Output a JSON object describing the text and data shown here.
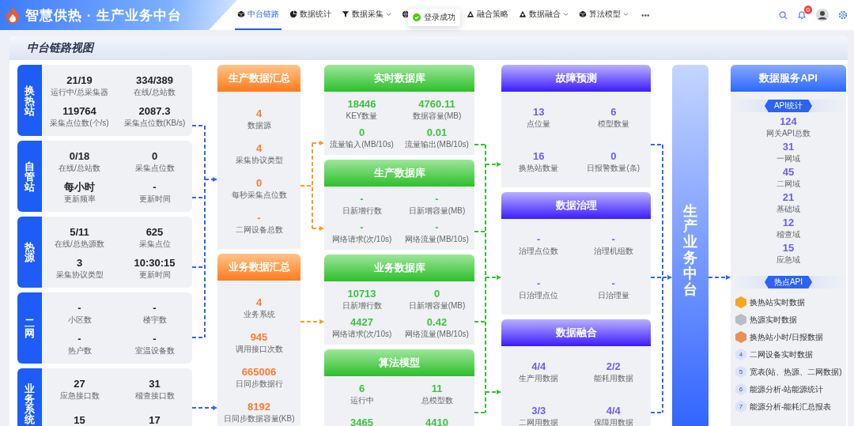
{
  "app": {
    "title": "智慧供热 · 生产业务中台"
  },
  "nav": [
    {
      "label": "中台链路",
      "selected": true,
      "dropdown": false
    },
    {
      "label": "数据统计",
      "selected": false,
      "dropdown": false
    },
    {
      "label": "数据采集",
      "selected": false,
      "dropdown": true
    },
    {
      "selected": false
    },
    {
      "label": "融合策略",
      "selected": false,
      "dropdown": false
    },
    {
      "label": "数据融合",
      "selected": false,
      "dropdown": true
    },
    {
      "label": "算法模型",
      "selected": false,
      "dropdown": true
    }
  ],
  "more": "•••",
  "notifications": {
    "badge": "0"
  },
  "toast": {
    "message": "登录成功"
  },
  "panel": {
    "title": "中台链路视图"
  },
  "sources": [
    {
      "name": "换热站",
      "metrics": [
        {
          "value": "21/19",
          "label": "运行中/总采集器"
        },
        {
          "value": "334/389",
          "label": "在线/总站数"
        },
        {
          "value": "119764",
          "label": "采集点位数(个/s)"
        },
        {
          "value": "2087.3",
          "label": "采集点位数(KB/s)"
        }
      ]
    },
    {
      "name": "自管站",
      "metrics": [
        {
          "value": "0/18",
          "label": "在线/总站数"
        },
        {
          "value": "0",
          "label": "采集点位数"
        },
        {
          "value": "每小时",
          "label": "更新频率"
        },
        {
          "value": "-",
          "label": "更新时间"
        }
      ]
    },
    {
      "name": "热源",
      "metrics": [
        {
          "value": "5/11",
          "label": "在线/总热源数"
        },
        {
          "value": "625",
          "label": "采集点位"
        },
        {
          "value": "3",
          "label": "采集协议类型"
        },
        {
          "value": "10:30:15",
          "label": "更新时间"
        }
      ]
    },
    {
      "name": "二网",
      "metrics": [
        {
          "value": "-",
          "label": "小区数"
        },
        {
          "value": "-",
          "label": "楼宇数"
        },
        {
          "value": "-",
          "label": "热户数"
        },
        {
          "value": "-",
          "label": "室温设备数"
        }
      ]
    },
    {
      "name": "业务系统",
      "metrics": [
        {
          "value": "27",
          "label": "应急接口数"
        },
        {
          "value": "31",
          "label": "稽查接口数"
        },
        {
          "value": "15"
        },
        {
          "value": "17"
        }
      ]
    }
  ],
  "summaries": [
    {
      "kind": "summary",
      "title": "生产数据汇总",
      "metrics": [
        {
          "value": "4",
          "label": "数据源"
        },
        {
          "value": "4",
          "label": "采集协议类型"
        },
        {
          "value": "0",
          "label": "每秒采集点位数"
        },
        {
          "value": "-",
          "label": "二网设备总数"
        }
      ]
    },
    {
      "kind": "summary",
      "title": "业务数据汇总",
      "metrics": [
        {
          "value": "4",
          "label": "业务系统"
        },
        {
          "value": "945",
          "label": "调用接口次数"
        },
        {
          "value": "665006",
          "label": "日同步数据行"
        },
        {
          "value": "8192",
          "label": "日同步数据容量(KB)"
        }
      ]
    }
  ],
  "databases": [
    {
      "kind": "database",
      "title": "实时数据库",
      "metrics": [
        {
          "value": "18446",
          "label": "KEY数量"
        },
        {
          "value": "4760.11",
          "label": "数据容量(MB)"
        },
        {
          "value": "0",
          "label": "流量输入(MB/10s)"
        },
        {
          "value": "0.01",
          "label": "流量输出(MB/10s)"
        }
      ]
    },
    {
      "kind": "database",
      "title": "生产数据库",
      "metrics": [
        {
          "value": "-",
          "label": "日新增行数"
        },
        {
          "value": "-",
          "label": "日新增容量(MB)"
        },
        {
          "value": "-",
          "label": "网络请求(次/10s)"
        },
        {
          "value": "-",
          "label": "网络流量(MB/10s)"
        }
      ]
    },
    {
      "kind": "database",
      "title": "业务数据库",
      "metrics": [
        {
          "value": "10713",
          "label": "日新增行数"
        },
        {
          "value": "0",
          "label": "日新增容量(MB)"
        },
        {
          "value": "4427",
          "label": "网络请求(次/10s)"
        },
        {
          "value": "0.42",
          "label": "网络流量(MB/10s)"
        }
      ]
    },
    {
      "kind": "database",
      "title": "算法模型",
      "metrics": [
        {
          "value": "6",
          "label": "运行中"
        },
        {
          "value": "11",
          "label": "总模型数"
        },
        {
          "value": "3465"
        },
        {
          "value": "4410"
        }
      ]
    }
  ],
  "services": [
    {
      "kind": "service",
      "title": "故障预测",
      "metrics": [
        {
          "value": "13",
          "label": "点位量"
        },
        {
          "value": "6",
          "label": "模型数量"
        },
        {
          "value": "16",
          "label": "换热站数量"
        },
        {
          "value": "0",
          "label": "日报警数量(条)"
        }
      ]
    },
    {
      "kind": "service",
      "title": "数据治理",
      "metrics": [
        {
          "value": "-",
          "label": "治理点位数"
        },
        {
          "value": "-",
          "label": "治理机组数"
        },
        {
          "value": "-",
          "label": "日治理点位"
        },
        {
          "value": "-",
          "label": "日治理量"
        }
      ]
    },
    {
      "kind": "service",
      "title": "数据融合",
      "metrics": [
        {
          "value": "4/4",
          "label": "生产用数据"
        },
        {
          "value": "2/2",
          "label": "能耗用数据"
        },
        {
          "value": "3/3",
          "label": "二网用数据"
        },
        {
          "value": "4/4",
          "label": "保障用数据"
        }
      ]
    }
  ],
  "hub": {
    "title": "生产业务中台"
  },
  "api": {
    "title": "数据服务API",
    "stats_title": "API统计",
    "stats": [
      {
        "value": "124",
        "label": "网关API总数"
      },
      {
        "value": "31",
        "label": "一网域"
      },
      {
        "value": "45",
        "label": "二网域"
      },
      {
        "value": "21",
        "label": "基础域"
      },
      {
        "value": "12",
        "label": "稽查域"
      },
      {
        "value": "15",
        "label": "应急域"
      }
    ],
    "hot_title": "热点API",
    "hot": [
      {
        "color": "#f5a623",
        "label": "换热站实时数据"
      },
      {
        "color": "#b8bcc6",
        "label": "热源实时数据"
      },
      {
        "color": "#e8905a",
        "label": "换热站小时/日报数据"
      },
      {
        "rank": "4",
        "label": "二网设备实时数据"
      },
      {
        "rank": "5",
        "label": "宽表(站、热源、二网数据)"
      },
      {
        "rank": "6",
        "label": "能源分析-站能源统计"
      },
      {
        "rank": "7",
        "label": "能源分析-能耗汇总报表"
      }
    ]
  }
}
